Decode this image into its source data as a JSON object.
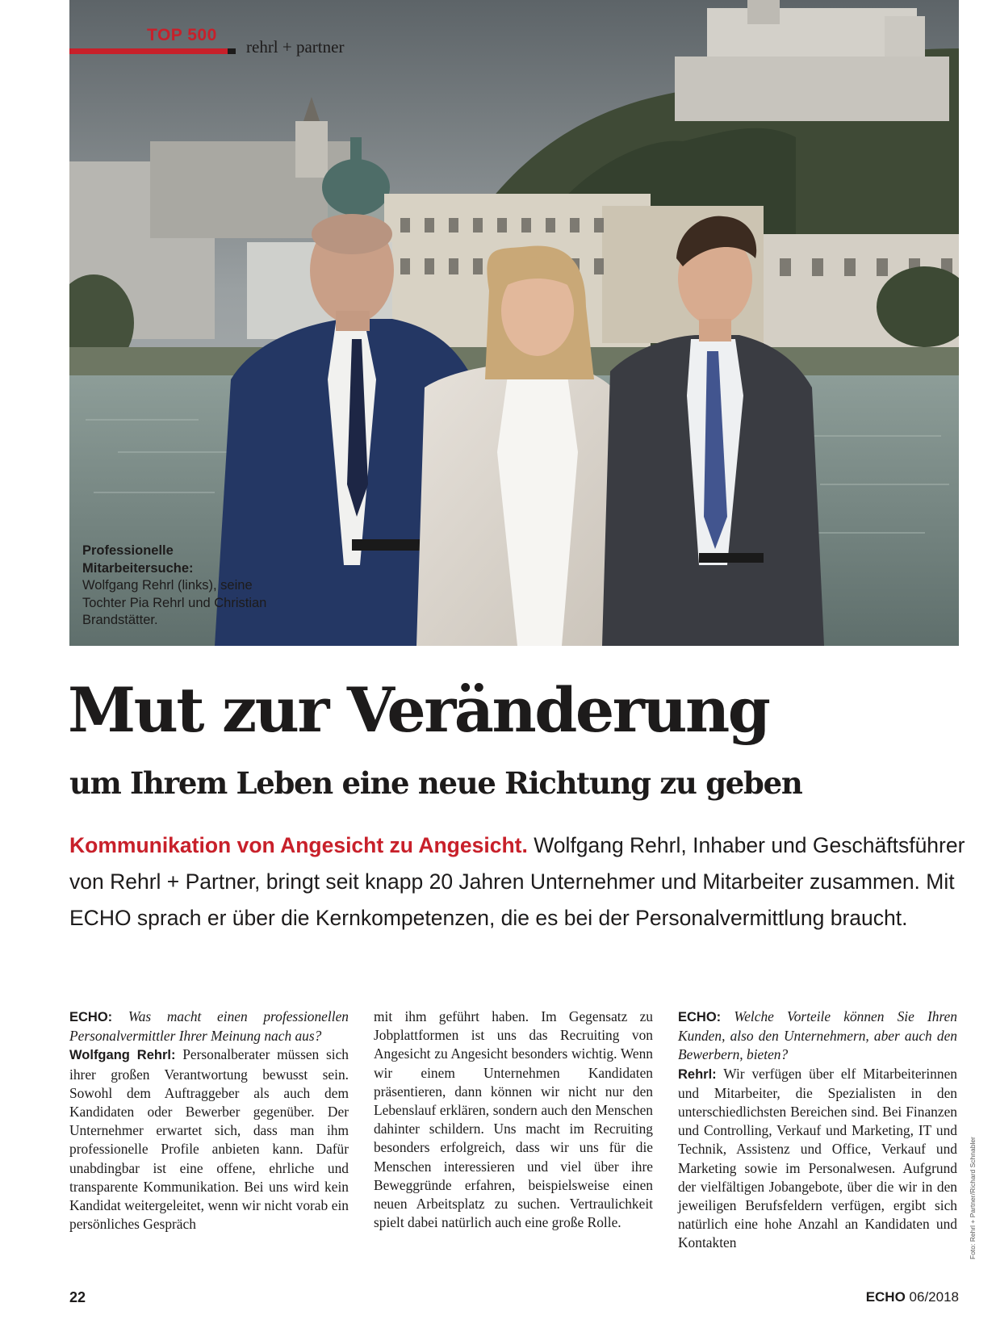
{
  "header": {
    "tag": "TOP 500",
    "section": "rehrl + partner"
  },
  "photo": {
    "caption_bold": "Professionelle Mitarbeitersuche:",
    "caption_text": "Wolfgang Rehrl (links), seine Tochter Pia Rehrl und Christian Brandstätter."
  },
  "article": {
    "headline": "Mut zur Veränderung",
    "subhead": "um Ihrem Leben eine neue Richtung zu geben",
    "lead_kicker": "Kommunikation von Angesicht zu Angesicht.",
    "lead_text": "Wolfgang Rehrl, Inhaber und Geschäftsführer von Rehrl + Partner, bringt seit knapp 20 Jahren Unternehmer und Mitarbeiter zusammen. Mit ECHO sprach er über die Kernkompetenzen, die es bei der Personalvermittlung braucht.",
    "col1": {
      "q_speaker": "ECHO:",
      "q_text": "Was macht einen professionellen Personalvermittler Ihrer Meinung nach aus?",
      "a_speaker": "Wolfgang Rehrl:",
      "a_text": "Personalberater müssen sich ihrer großen Verantwortung bewusst sein. Sowohl dem Auftraggeber als auch dem Kandidaten oder Bewerber gegenüber. Der Unternehmer erwartet sich, dass man ihm professionelle Profile anbieten kann. Dafür unabdingbar ist eine offene, ehrliche und transparente Kommunikation. Bei uns wird kein Kandidat weitergeleitet, wenn wir nicht vorab ein persönliches Gespräch"
    },
    "col2": {
      "text": "mit ihm geführt haben. Im Gegensatz zu Jobplattformen ist uns das Recruiting von Angesicht zu Angesicht besonders wichtig. Wenn wir einem Unternehmen Kandidaten präsentieren, dann können wir nicht nur den Lebenslauf erklären, sondern auch den Menschen dahinter schildern. Uns macht im Recruiting besonders erfolgreich, dass wir uns für die Menschen interessieren und viel über ihre Beweggründe erfahren, beispielsweise einen neuen Arbeitsplatz zu suchen. Vertraulichkeit spielt dabei natürlich auch eine große Rolle."
    },
    "col3": {
      "q_speaker": "ECHO:",
      "q_text": "Welche Vorteile können Sie Ihren Kunden, also den Unternehmern, aber auch den Bewerbern, bieten?",
      "a_speaker": "Rehrl:",
      "a_text": "Wir verfügen über elf Mitarbeiterinnen und Mitarbeiter, die Spezialisten in den unterschiedlichsten Bereichen sind. Bei Finanzen und Controlling, Verkauf und Marketing, IT und Technik, Assistenz und Office, Verkauf und Marketing sowie im Personalwesen. Aufgrund der vielfältigen Jobangebote, über die wir in den jeweiligen Berufsfeldern verfügen, ergibt sich natürlich eine hohe Anzahl an Kandidaten und Kontakten"
    }
  },
  "photo_credit": "Foto: Rehrl + Partner/Richard Schnabler",
  "footer": {
    "page_number": "22",
    "magazine": "ECHO",
    "issue": "06/2018"
  },
  "colors": {
    "accent_red": "#c8202a",
    "text": "#1d1b1b"
  }
}
